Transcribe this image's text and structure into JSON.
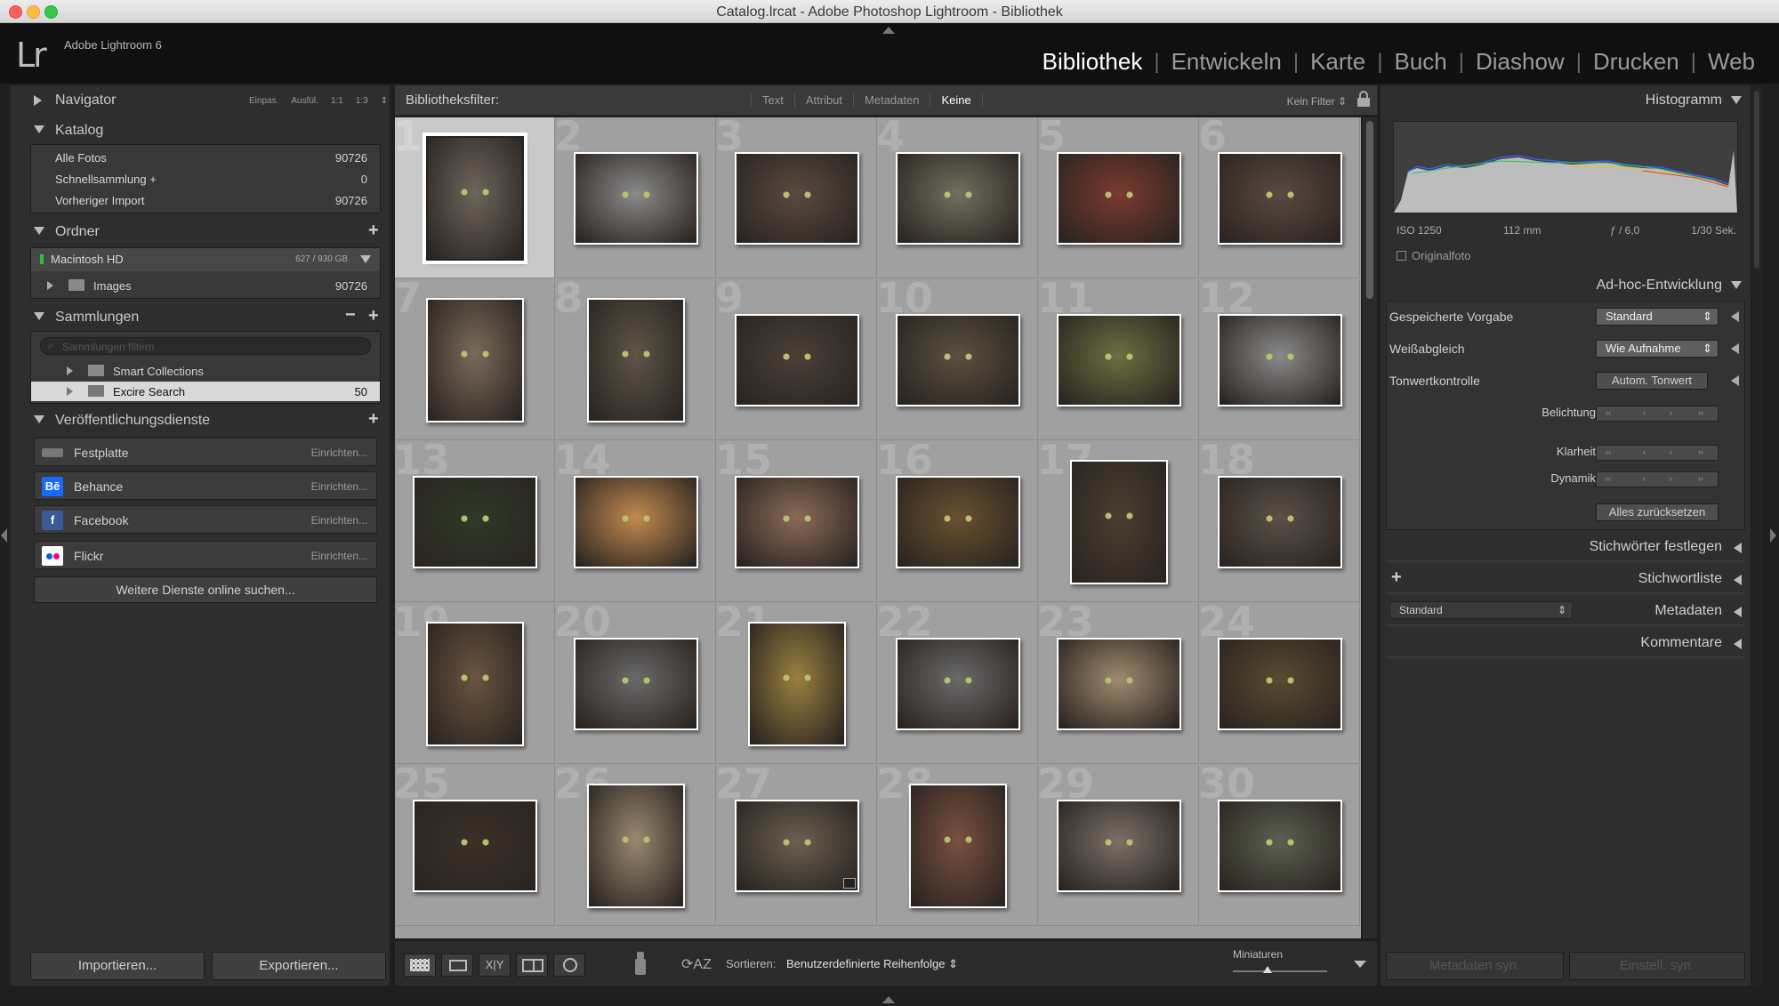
{
  "window": {
    "title": "Catalog.lrcat - Adobe Photoshop Lightroom - Bibliothek"
  },
  "identity": {
    "logo": "Lr",
    "product": "Adobe Lightroom 6"
  },
  "modules": [
    "Bibliothek",
    "Entwickeln",
    "Karte",
    "Buch",
    "Diashow",
    "Drucken",
    "Web"
  ],
  "active_module": "Bibliothek",
  "left": {
    "navigator": {
      "label": "Navigator",
      "zooms": [
        "Einpas.",
        "Ausfül.",
        "1:1",
        "1:3"
      ]
    },
    "katalog": {
      "label": "Katalog",
      "items": [
        {
          "label": "Alle Fotos",
          "count": "90726"
        },
        {
          "label": "Schnellsammlung +",
          "count": "0"
        },
        {
          "label": "Vorheriger Import",
          "count": "90726"
        }
      ]
    },
    "ordner": {
      "label": "Ordner",
      "drive": "Macintosh HD",
      "drive_space": "627 / 930 GB",
      "folder": "Images",
      "folder_count": "90726"
    },
    "sammlungen": {
      "label": "Sammlungen",
      "search_placeholder": "Sammlungen filtern",
      "items": [
        {
          "label": "Smart Collections",
          "count": ""
        },
        {
          "label": "Excire Search",
          "count": "50"
        }
      ]
    },
    "publish": {
      "label": "Veröffentlichungsdienste",
      "services": [
        {
          "name": "Festplatte",
          "action": "Einrichten..."
        },
        {
          "name": "Behance",
          "action": "Einrichten..."
        },
        {
          "name": "Facebook",
          "action": "Einrichten..."
        },
        {
          "name": "Flickr",
          "action": "Einrichten..."
        }
      ],
      "more": "Weitere Dienste online suchen..."
    },
    "import_btn": "Importieren...",
    "export_btn": "Exportieren..."
  },
  "filterbar": {
    "label": "Bibliotheksfilter:",
    "tabs": [
      "Text",
      "Attribut",
      "Metadaten",
      "Keine"
    ],
    "active": "Keine",
    "preset": "Kein Filter"
  },
  "grid": {
    "cells": [
      {
        "n": "1",
        "ar": "portrait",
        "tone": "#6e655c"
      },
      {
        "n": "2",
        "ar": "landscape",
        "tone": "#8a8a8a"
      },
      {
        "n": "3",
        "ar": "landscape",
        "tone": "#5a4a40"
      },
      {
        "n": "4",
        "ar": "landscape",
        "tone": "#707060"
      },
      {
        "n": "5",
        "ar": "landscape",
        "tone": "#7a3a30"
      },
      {
        "n": "6",
        "ar": "landscape",
        "tone": "#5a4a40"
      },
      {
        "n": "7",
        "ar": "portrait",
        "tone": "#7b6a5a"
      },
      {
        "n": "8",
        "ar": "portrait",
        "tone": "#5e5548"
      },
      {
        "n": "9",
        "ar": "landscape",
        "tone": "#4a4038"
      },
      {
        "n": "10",
        "ar": "landscape",
        "tone": "#5a5040"
      },
      {
        "n": "11",
        "ar": "landscape",
        "tone": "#6a7040"
      },
      {
        "n": "12",
        "ar": "landscape",
        "tone": "#8a8a8a"
      },
      {
        "n": "13",
        "ar": "landscape",
        "tone": "#2e3a28"
      },
      {
        "n": "14",
        "ar": "landscape",
        "tone": "#c28a50"
      },
      {
        "n": "15",
        "ar": "landscape",
        "tone": "#8a6a58"
      },
      {
        "n": "16",
        "ar": "landscape",
        "tone": "#6a5030"
      },
      {
        "n": "17",
        "ar": "portrait",
        "tone": "#4a3e30"
      },
      {
        "n": "18",
        "ar": "landscape",
        "tone": "#5a5048"
      },
      {
        "n": "19",
        "ar": "portrait",
        "tone": "#6a5440"
      },
      {
        "n": "20",
        "ar": "landscape",
        "tone": "#6a6a6a"
      },
      {
        "n": "21",
        "ar": "portrait",
        "tone": "#9a8040"
      },
      {
        "n": "22",
        "ar": "landscape",
        "tone": "#6a6a6a"
      },
      {
        "n": "23",
        "ar": "landscape",
        "tone": "#a08a70"
      },
      {
        "n": "24",
        "ar": "landscape",
        "tone": "#5a4a30"
      },
      {
        "n": "25",
        "ar": "landscape",
        "tone": "#3a3028"
      },
      {
        "n": "26",
        "ar": "portrait",
        "tone": "#9a8870"
      },
      {
        "n": "27",
        "ar": "landscape",
        "tone": "#6a6050"
      },
      {
        "n": "28",
        "ar": "portrait",
        "tone": "#7a5040"
      },
      {
        "n": "29",
        "ar": "landscape",
        "tone": "#7a7068"
      },
      {
        "n": "30",
        "ar": "landscape",
        "tone": "#5a6050"
      }
    ]
  },
  "toolbar": {
    "sort_label": "Sortieren:",
    "sort_value": "Benutzerdefinierte Reihenfolge",
    "thumb_label": "Miniaturen"
  },
  "right": {
    "histogramm": {
      "label": "Histogramm",
      "iso": "ISO 1250",
      "focal": "112 mm",
      "aperture": "ƒ / 6,0",
      "shutter": "1/30 Sek.",
      "original": "Originalfoto"
    },
    "adhoc": {
      "label": "Ad-hoc-Entwicklung",
      "preset_label": "Gespeicherte Vorgabe",
      "preset_value": "Standard",
      "wb_label": "Weißabgleich",
      "wb_value": "Wie Aufnahme",
      "tone_label": "Tonwertkontrolle",
      "tone_btn": "Autom. Tonwert",
      "belichtung": "Belichtung",
      "klarheit": "Klarheit",
      "dynamik": "Dynamik",
      "reset": "Alles zurücksetzen"
    },
    "stichwort_set": "Stichwörter festlegen",
    "stichwortliste": "Stichwortliste",
    "metadaten": {
      "label": "Metadaten",
      "preset": "Standard"
    },
    "kommentare": "Kommentare",
    "sync_meta": "Metadaten syn.",
    "sync_settings": "Einstell. syn."
  }
}
